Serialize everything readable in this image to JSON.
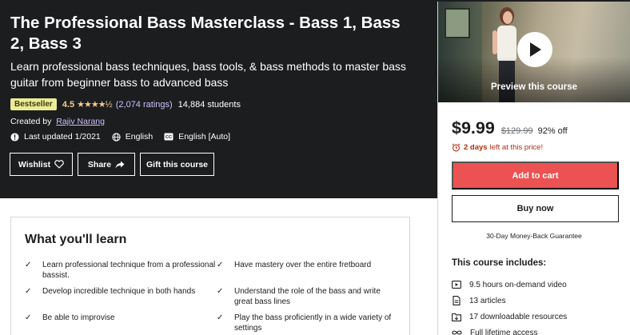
{
  "course": {
    "title": "The Professional Bass Masterclass - Bass 1, Bass 2, Bass 3",
    "subtitle": "Learn professional bass techniques, bass tools, & bass methods to master bass guitar from beginner bass to advanced bass",
    "badge": "Bestseller",
    "rating": "4.5",
    "stars": "★★★★½",
    "ratings_count": "(2,074 ratings)",
    "students": "14,884 students",
    "created_by_label": "Created by",
    "instructor": "Rajiv Narang",
    "last_updated": "Last updated 1/2021",
    "language": "English",
    "captions": "English [Auto]"
  },
  "actions": {
    "wishlist": "Wishlist",
    "share": "Share",
    "gift": "Gift this course"
  },
  "sidebar": {
    "preview_label": "Preview this course",
    "price": "$9.99",
    "original_price": "$129.99",
    "discount": "92% off",
    "countdown_bold": "2 days",
    "countdown_rest": "left at this price!",
    "add_to_cart": "Add to cart",
    "buy_now": "Buy now",
    "guarantee": "30-Day Money-Back Guarantee",
    "includes_title": "This course includes:",
    "includes": [
      {
        "icon": "video-icon",
        "text": "9.5 hours on-demand video"
      },
      {
        "icon": "article-icon",
        "text": "13 articles"
      },
      {
        "icon": "download-icon",
        "text": "17 downloadable resources"
      },
      {
        "icon": "infinity-icon",
        "text": "Full lifetime access"
      }
    ]
  },
  "learn": {
    "title": "What you'll learn",
    "items": [
      "Learn professional technique from a professional bassist.",
      "Have mastery over the entire fretboard",
      "Develop incredible technique in both hands",
      "Understand the role of the bass and write great bass lines",
      "Be able to improvise",
      "Play the bass proficiently in a wide variety of settings"
    ]
  },
  "colors": {
    "hero_bg": "#1c1d1f",
    "accent_purple": "#cec0fc",
    "star_gold": "#f3ca8c",
    "badge_bg": "#eceb98",
    "cart_red": "#ec5252",
    "countdown_red": "#b32d0f"
  }
}
